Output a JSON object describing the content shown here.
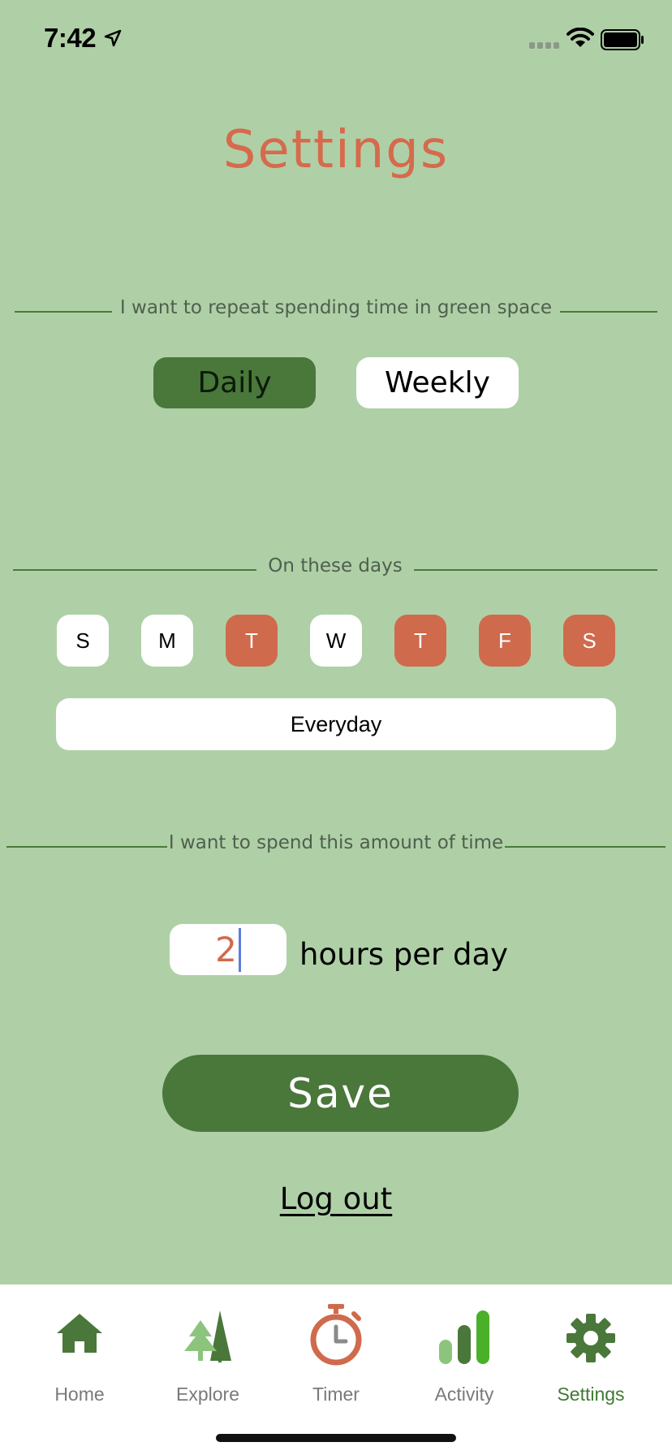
{
  "status_bar": {
    "time": "7:42"
  },
  "page": {
    "title": "Settings"
  },
  "repeat_section": {
    "label": "I want to repeat spending time in green space",
    "options": [
      "Daily",
      "Weekly"
    ],
    "selected": "Daily"
  },
  "days_section": {
    "label": "On these days",
    "days": [
      {
        "letter": "S",
        "selected": false
      },
      {
        "letter": "M",
        "selected": false
      },
      {
        "letter": "T",
        "selected": true
      },
      {
        "letter": "W",
        "selected": false
      },
      {
        "letter": "T",
        "selected": true
      },
      {
        "letter": "F",
        "selected": true
      },
      {
        "letter": "S",
        "selected": true
      }
    ],
    "everyday_label": "Everyday"
  },
  "time_section": {
    "label": "I want to spend this amount of time",
    "hours_value": "2",
    "hours_unit_label": "hours per day"
  },
  "actions": {
    "save_label": "Save",
    "logout_label": "Log out"
  },
  "tabbar": {
    "items": [
      {
        "label": "Home",
        "icon": "house-icon",
        "active": false
      },
      {
        "label": "Explore",
        "icon": "trees-icon",
        "active": false
      },
      {
        "label": "Timer",
        "icon": "stopwatch-icon",
        "active": false
      },
      {
        "label": "Activity",
        "icon": "bars-icon",
        "active": false
      },
      {
        "label": "Settings",
        "icon": "gear-icon",
        "active": true
      }
    ]
  },
  "colors": {
    "background": "#afd0a6",
    "accent_green": "#4a773a",
    "accent_orange": "#d06a4d",
    "title_orange": "#d66a4d"
  }
}
